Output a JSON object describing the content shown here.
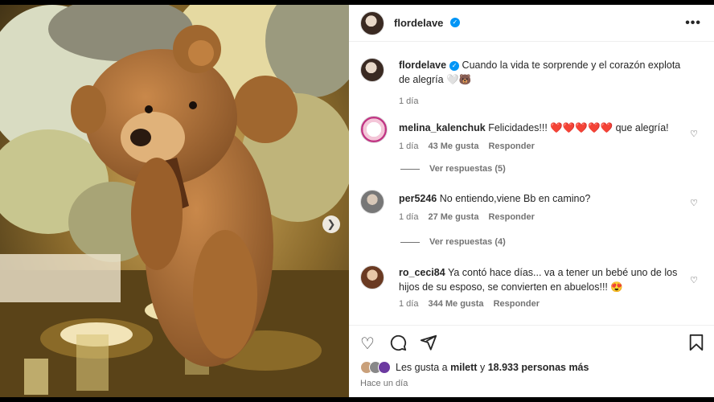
{
  "post": {
    "username": "flordelave",
    "verified_icon": "verified-badge-icon",
    "more_icon": "more-options-icon",
    "caption": "Cuando la vida te sorprende y el corazón explota de alegría 🤍🐻",
    "caption_time": "1 día"
  },
  "comments": [
    {
      "user": "melina_kalenchuk",
      "text": "Felicidades!!! ❤️❤️❤️❤️❤️ que alegría!",
      "time": "1 día",
      "likes": "43 Me gusta",
      "reply": "Responder",
      "view_replies": "Ver respuestas (5)"
    },
    {
      "user": "per5246",
      "text": "No entiendo,viene Bb en camino?",
      "time": "1 día",
      "likes": "27 Me gusta",
      "reply": "Responder",
      "view_replies": "Ver respuestas (4)"
    },
    {
      "user": "ro_ceci84",
      "text": "Ya contó hace días... va a tener un bebé uno de los hijos de su esposo, se convierten en abuelos!!! 😍",
      "time": "1 día",
      "likes": "344 Me gusta",
      "reply": "Responder"
    }
  ],
  "footer": {
    "likes_prefix": "Les gusta a",
    "likes_user": "milett",
    "likes_conj": "y",
    "likes_count": "18.933 personas más",
    "time": "Hace un día"
  },
  "colors": {
    "verified": "#0095f6",
    "muted": "#737373",
    "heart": "#ed1c24"
  }
}
